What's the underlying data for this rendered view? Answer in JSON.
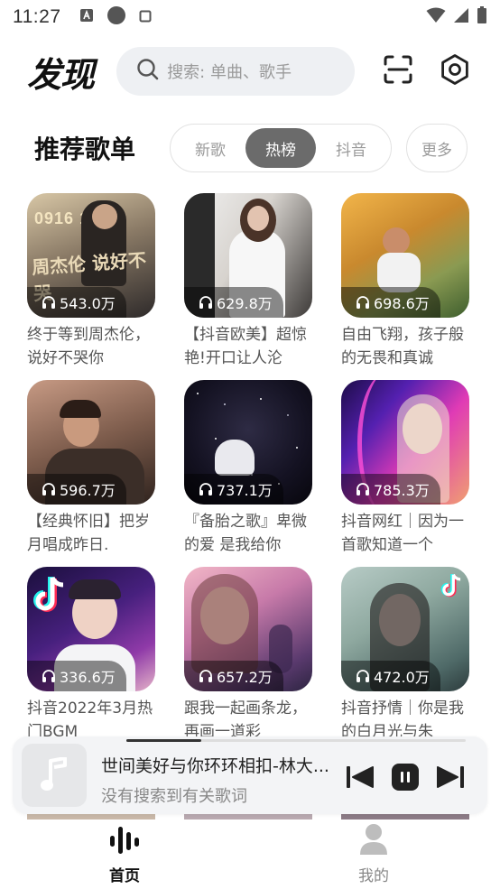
{
  "status_bar": {
    "time": "11:27"
  },
  "header": {
    "logo": "发现",
    "search_placeholder": "搜索: 单曲、歌手"
  },
  "section": {
    "title": "推荐歌单",
    "tabs": [
      {
        "label": "新歌",
        "active": false
      },
      {
        "label": "热榜",
        "active": true
      },
      {
        "label": "抖音",
        "active": false
      }
    ],
    "more_label": "更多"
  },
  "playlists": [
    {
      "play_count": "543.0万",
      "title": "终于等到周杰伦，说好不哭你"
    },
    {
      "play_count": "629.8万",
      "title": "【抖音欧美】超惊艳!开口让人沦"
    },
    {
      "play_count": "698.6万",
      "title": "自由飞翔，孩子般的无畏和真诚"
    },
    {
      "play_count": "596.7万",
      "title": "【经典怀旧】把岁月唱成昨日."
    },
    {
      "play_count": "737.1万",
      "title": "『备胎之歌』卑微的爱 是我给你"
    },
    {
      "play_count": "785.3万",
      "title": "抖音网红｜因为一首歌知道一个"
    },
    {
      "play_count": "336.6万",
      "title": "抖音2022年3月热门BGM"
    },
    {
      "play_count": "657.2万",
      "title": "跟我一起画条龙，再画一道彩"
    },
    {
      "play_count": "472.0万",
      "title": "抖音抒情｜你是我的白月光与朱"
    }
  ],
  "cover_texts": {
    "c1_top": "0916  11PM",
    "c1_main": "周杰伦 说好不哭"
  },
  "player": {
    "title": "世间美好与你环环相扣-林大...",
    "subtitle": "没有搜索到有关歌词",
    "progress": 0.22
  },
  "bottom_nav": {
    "home_label": "首页",
    "mine_label": "我的"
  },
  "colors": {
    "active_tab_bg": "#6b6b6b",
    "search_bg": "#eef0f3",
    "player_bg": "#f3f4f6",
    "nav_active": "#111111",
    "nav_inactive": "#888888"
  },
  "icons": [
    "search-icon",
    "scan-icon",
    "gear-icon",
    "headphones-icon",
    "music-note-icon",
    "skip-previous-icon",
    "pause-icon",
    "skip-next-icon",
    "home-bars-icon",
    "person-icon"
  ]
}
